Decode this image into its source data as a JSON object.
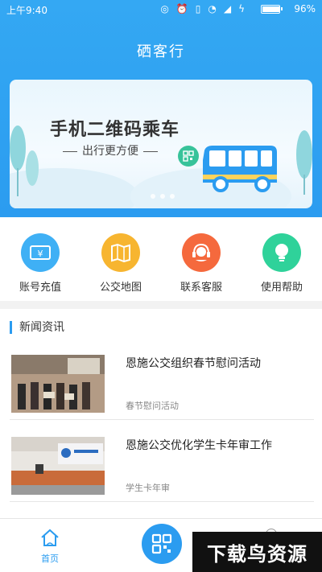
{
  "status_bar": {
    "time": "上午9:40",
    "battery": "96%",
    "battery_level": 0.96
  },
  "header": {
    "title": "硒客行"
  },
  "banner": {
    "title": "手机二维码乘车",
    "subtitle": "出行更方便"
  },
  "quick_menu": [
    {
      "label": "账号充值",
      "icon": "wallet-icon",
      "color": "#3fb0f5"
    },
    {
      "label": "公交地图",
      "icon": "map-icon",
      "color": "#f7b530"
    },
    {
      "label": "联系客服",
      "icon": "headset-icon",
      "color": "#f5693d"
    },
    {
      "label": "使用帮助",
      "icon": "lightbulb-icon",
      "color": "#2fd29a"
    }
  ],
  "news": {
    "section_title": "新闻资讯",
    "items": [
      {
        "title": "恩施公交组织春节慰问活动",
        "tag": "春节慰问活动"
      },
      {
        "title": "恩施公交优化学生卡年审工作",
        "tag": "学生卡年审"
      }
    ]
  },
  "tabbar": {
    "home_label": "首页",
    "qr_icon": "qr-code-icon"
  },
  "watermark": {
    "text": "下载鸟资源"
  },
  "colors": {
    "primary": "#2b9cf0"
  }
}
